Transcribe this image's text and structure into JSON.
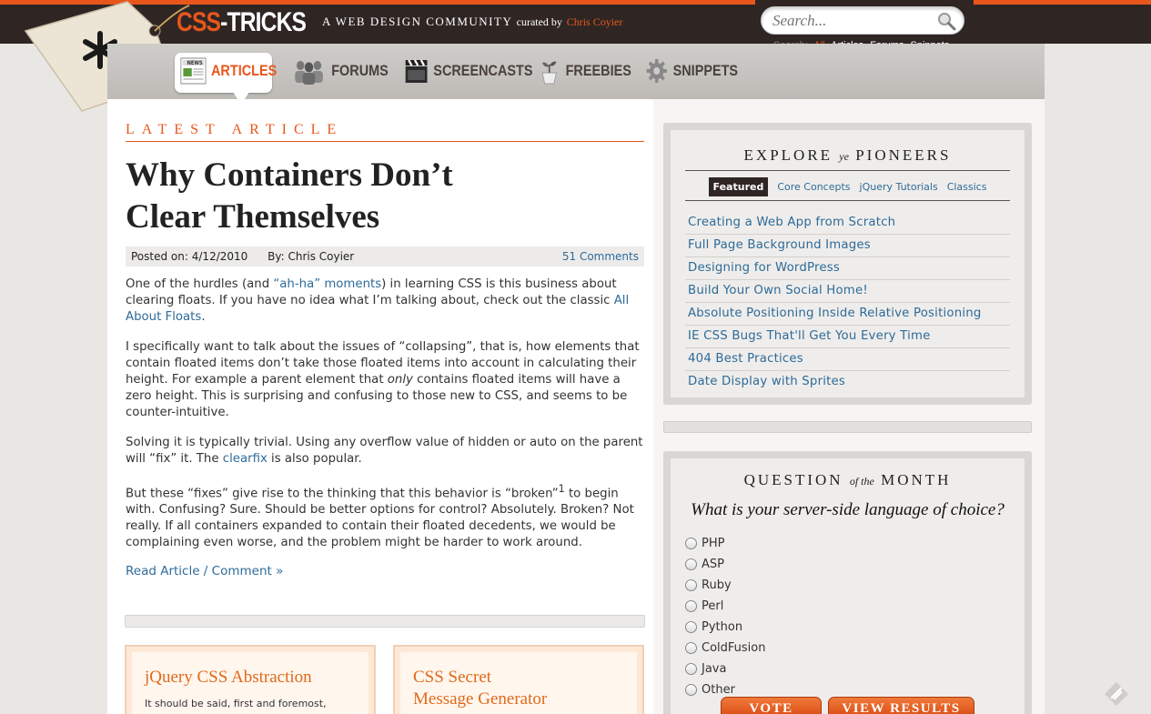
{
  "header": {
    "logo_part1": "CSS",
    "logo_part2": "-TRICKS",
    "tagline": "A WEB DESIGN COMMUNITY",
    "curated_by": "curated by",
    "curator": "Chris Coyier"
  },
  "search": {
    "placeholder": "Search...",
    "label": "Search:",
    "options": [
      "All",
      "Articles",
      "Forums",
      "Snippets"
    ],
    "active_option": "All"
  },
  "nav": {
    "items": [
      {
        "label": "ARTICLES",
        "icon": "newspaper-icon"
      },
      {
        "label": "FORUMS",
        "icon": "people-icon"
      },
      {
        "label": "SCREENCASTS",
        "icon": "clapperboard-icon"
      },
      {
        "label": "FREEBIES",
        "icon": "plant-icon"
      },
      {
        "label": "SNIPPETS",
        "icon": "gear-icon"
      }
    ],
    "active": "ARTICLES",
    "news_badge": "NEWS"
  },
  "article": {
    "section_label": "LATEST ARTICLE",
    "title_line1": "Why Containers Don’t",
    "title_line2": "Clear Themselves",
    "posted_label": "Posted on:",
    "posted_date": "4/12/2010",
    "by_label": "By:",
    "author": "Chris Coyier",
    "comments": "51 Comments",
    "p1_a": "One of the hurdles (and ",
    "p1_link1": "“ah-ha” moments",
    "p1_b": ") in learning CSS is this business about clearing floats. If you have no idea what I’m talking about, check out the classic ",
    "p1_link2": "All About Floats",
    "p1_c": ".",
    "p2_a": "I specifically want to talk about the issues of “collapsing”, that is, how elements that contain floated items don’t take those floated items into account in calculating their height. For example a parent element that ",
    "p2_em": "only",
    "p2_b": " contains floated items will have a zero height. This is surprising and confusing to those new to CSS, and seems to be counter-intuitive.",
    "p3_a": "Solving it is typically trivial. Using any overflow value of hidden or auto on the parent will “fix” it. The ",
    "p3_link": "clearfix",
    "p3_b": " is also popular.",
    "p4_a": "But these “fixes” give rise to the thinking that this behavior is “broken”",
    "p4_sup": "1",
    "p4_b": " to begin with. Confusing? Sure. Should be better options for control? Absolutely. Broken? Not really. If all containers expanded to contain their floated decedents, we would be complaining even worse, and the problem might be harder to work around.",
    "read_more": "Read Article / Comment »"
  },
  "cards": [
    {
      "title_line1": "jQuery CSS Abstraction",
      "title_line2": "",
      "text": "It should be said, first and foremost,"
    },
    {
      "title_line1": "CSS Secret",
      "title_line2": "Message Generator",
      "text": ""
    }
  ],
  "explore": {
    "heading_a": "EXPLORE",
    "heading_ye": "ye",
    "heading_b": "PIONEERS",
    "tabs": [
      "Featured",
      "Core Concepts",
      "jQuery Tutorials",
      "Classics"
    ],
    "active_tab": "Featured",
    "links": [
      "Creating a Web App from Scratch",
      "Full Page Background Images",
      "Designing for WordPress",
      "Build Your Own Social Home!",
      "Absolute Positioning Inside Relative Positioning",
      "IE CSS Bugs That'll Get You Every Time",
      "404 Best Practices",
      "Date Display with Sprites"
    ]
  },
  "poll": {
    "heading_a": "QUESTION",
    "heading_of": "of the",
    "heading_b": "MONTH",
    "question": "What is your server-side language of choice?",
    "options": [
      "PHP",
      "ASP",
      "Ruby",
      "Perl",
      "Python",
      "ColdFusion",
      "Java",
      "Other"
    ],
    "vote_label": "VOTE",
    "results_label": "VIEW RESULTS"
  },
  "colors": {
    "accent": "#e8561c",
    "header_bg": "#2f2624",
    "link": "#2e6b99"
  }
}
